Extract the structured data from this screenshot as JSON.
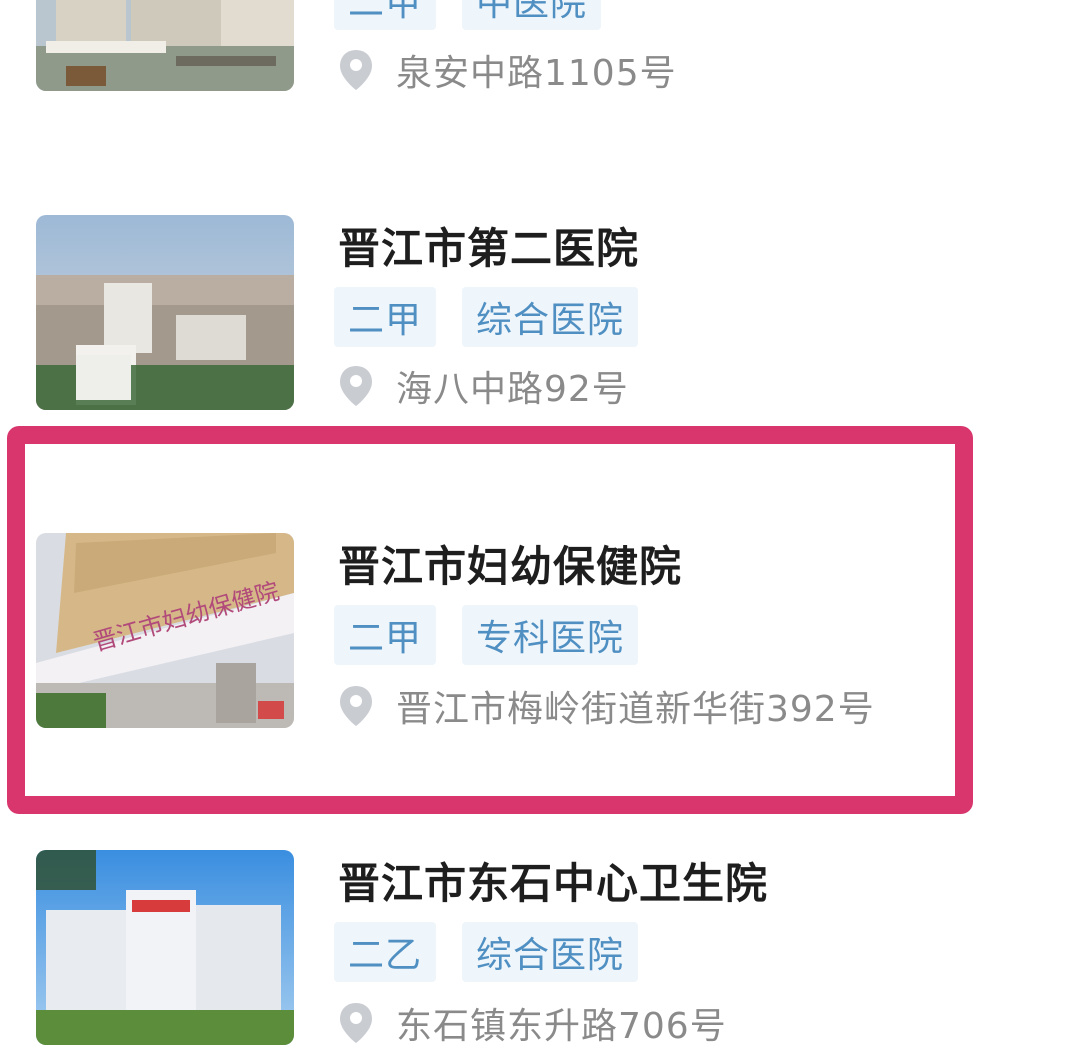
{
  "hospitals": [
    {
      "name": "",
      "level": "二甲",
      "type": "中医院",
      "address": "泉安中路1105号"
    },
    {
      "name": "晋江市第二医院",
      "level": "二甲",
      "type": "综合医院",
      "address": "海八中路92号"
    },
    {
      "name": "晋江市妇幼保健院",
      "level": "二甲",
      "type": "专科医院",
      "address": "晋江市梅岭街道新华街392号",
      "thumb_sign": "晋江市妇幼保健院"
    },
    {
      "name": "晋江市东石中心卫生院",
      "level": "二乙",
      "type": "综合医院",
      "address": "东石镇东升路706号"
    }
  ],
  "colors": {
    "highlight": "#d8366c",
    "tag_text": "#4f8fc2",
    "tag_bg": "#eef5fb",
    "title": "#1e1e1e",
    "address": "#8a8a8a",
    "pin": "#c9ccd1"
  },
  "icons": {
    "location": "map-pin-icon"
  }
}
